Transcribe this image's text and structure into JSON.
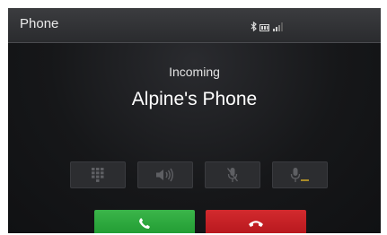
{
  "header": {
    "title": "Phone",
    "icons": [
      "bluetooth-icon",
      "battery-icon",
      "signal-strength-icon"
    ]
  },
  "call": {
    "status": "Incoming",
    "caller_name": "Alpine's Phone"
  },
  "controls": [
    {
      "name": "keypad-icon",
      "enabled": false
    },
    {
      "name": "speaker-icon",
      "enabled": false
    },
    {
      "name": "mute-microphone-icon",
      "enabled": false
    },
    {
      "name": "microphone-volume-icon",
      "enabled": false
    }
  ],
  "actions": {
    "accept_icon": "phone-answer-icon",
    "decline_icon": "phone-hangup-icon"
  },
  "colors": {
    "accept": "#2aa83c",
    "decline": "#c81e23",
    "background": "#111214"
  }
}
